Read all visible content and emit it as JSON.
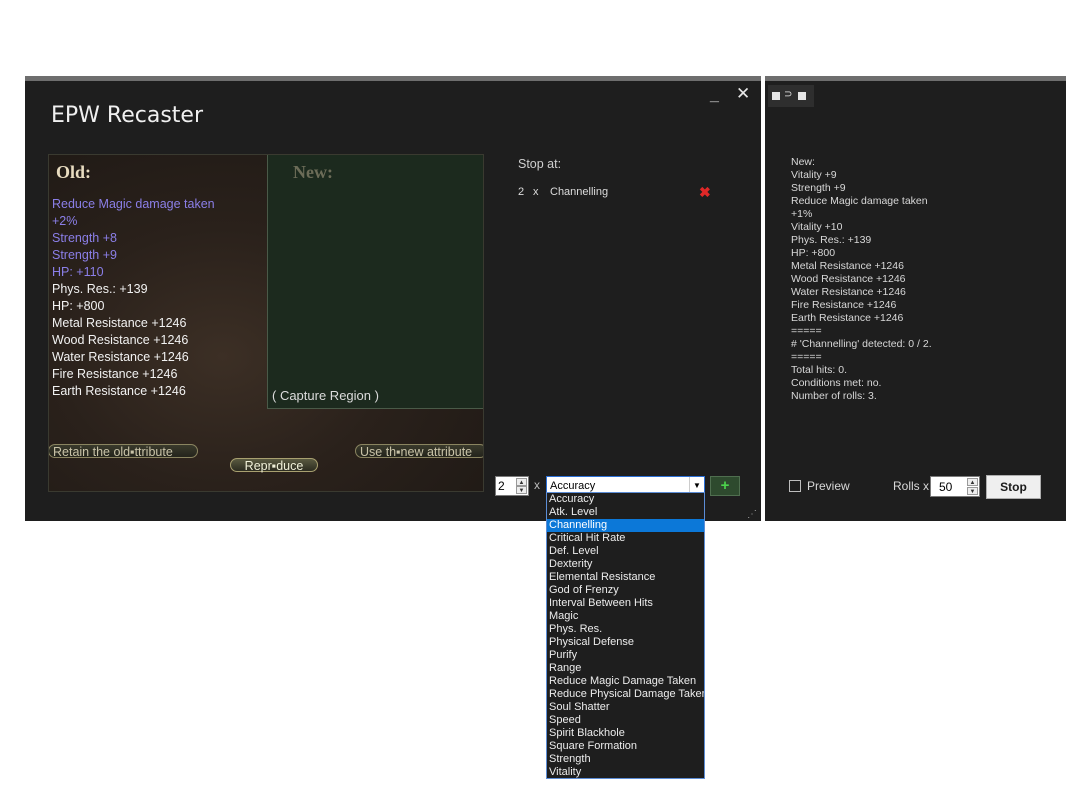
{
  "window": {
    "title": "EPW Recaster",
    "minimize_label": "_",
    "close_label": "✕"
  },
  "game": {
    "old_title": "Old:",
    "new_title": "New:",
    "old_lines": [
      {
        "text": "Reduce Magic damage taken",
        "color": "blue"
      },
      {
        "text": "+2%",
        "color": "blue"
      },
      {
        "text": "Strength +8",
        "color": "blue"
      },
      {
        "text": "Strength +9",
        "color": "blue"
      },
      {
        "text": "HP: +110",
        "color": "blue"
      },
      {
        "text": "Phys. Res.: +139",
        "color": "white"
      },
      {
        "text": "HP: +800",
        "color": "white"
      },
      {
        "text": "Metal Resistance +1246",
        "color": "white"
      },
      {
        "text": "Wood Resistance +1246",
        "color": "white"
      },
      {
        "text": "Water Resistance +1246",
        "color": "white"
      },
      {
        "text": "Fire Resistance +1246",
        "color": "white"
      },
      {
        "text": "Earth Resistance +1246",
        "color": "white"
      }
    ],
    "capture_label": "( Capture Region )",
    "retain_button": "Retain the old▪ttribute",
    "use_button": "Use th▪new attribute",
    "reproduce_button": "Repr▪duce"
  },
  "stop_at": {
    "label": "Stop at:",
    "rules": [
      {
        "count": "2",
        "x": "x",
        "attribute": "Channelling",
        "remove_icon": "✖"
      }
    ]
  },
  "controls": {
    "quantity": "2",
    "times_label": "x",
    "selected_attribute": "Accuracy",
    "add_label": "+",
    "dropdown_arrow": "▼"
  },
  "dropdown": {
    "options": [
      "Accuracy",
      "Atk. Level",
      "Channelling",
      "Critical Hit Rate",
      "Def. Level",
      "Dexterity",
      "Elemental Resistance",
      "God of Frenzy",
      "Interval Between Hits",
      "Magic",
      "Phys. Res.",
      "Physical Defense",
      "Purify",
      "Range",
      "Reduce Magic Damage Taken",
      "Reduce Physical Damage Taken",
      "Soul Shatter",
      "Speed",
      "Spirit Blackhole",
      "Square Formation",
      "Strength",
      "Vitality"
    ],
    "highlighted": "Channelling"
  },
  "log": {
    "text": "New:\nVitality +9\nStrength +9\nReduce Magic damage taken\n+1%\nVitality +10\nPhys. Res.: +139\nHP: +800\nMetal Resistance +1246\nWood Resistance +1246\nWater Resistance +1246\nFire Resistance +1246\nEarth Resistance +1246\n=====\n# 'Channelling' detected: 0 / 2.\n=====\nTotal hits: 0.\nConditions met: no.\nNumber of rolls: 3.",
    "preview_label": "Preview",
    "rolls_label": "Rolls x",
    "rolls_value": "50",
    "stop_button": "Stop"
  },
  "colors": {
    "window_bg": "#1e1e1e",
    "accent_blue": "#0c78d8",
    "remove_red": "#e02828",
    "add_green": "#4cd24c",
    "old_attr_blue": "#8b7fe8"
  }
}
